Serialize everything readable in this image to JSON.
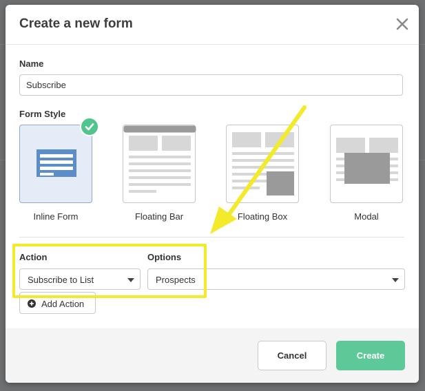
{
  "modal": {
    "title": "Create a new form"
  },
  "name_field": {
    "label": "Name",
    "value": "Subscribe"
  },
  "form_style": {
    "label": "Form Style",
    "options": [
      {
        "label": "Inline Form",
        "selected": true
      },
      {
        "label": "Floating Bar",
        "selected": false
      },
      {
        "label": "Floating Box",
        "selected": false
      },
      {
        "label": "Modal",
        "selected": false
      }
    ]
  },
  "action_section": {
    "action_label": "Action",
    "options_label": "Options",
    "action_value": "Subscribe to List",
    "options_value": "Prospects",
    "add_action_label": "Add Action"
  },
  "footer": {
    "cancel_label": "Cancel",
    "create_label": "Create"
  },
  "colors": {
    "accent_green": "#5dc998",
    "check_green": "#52c58f",
    "inline_blue": "#5b8dc9",
    "highlight_yellow": "#f2ea2a",
    "overlay_gray": "#6e6f71"
  },
  "icons": {
    "close": "close-icon",
    "check": "check-icon",
    "plus": "plus-circle-icon",
    "caret": "caret-down-icon"
  }
}
